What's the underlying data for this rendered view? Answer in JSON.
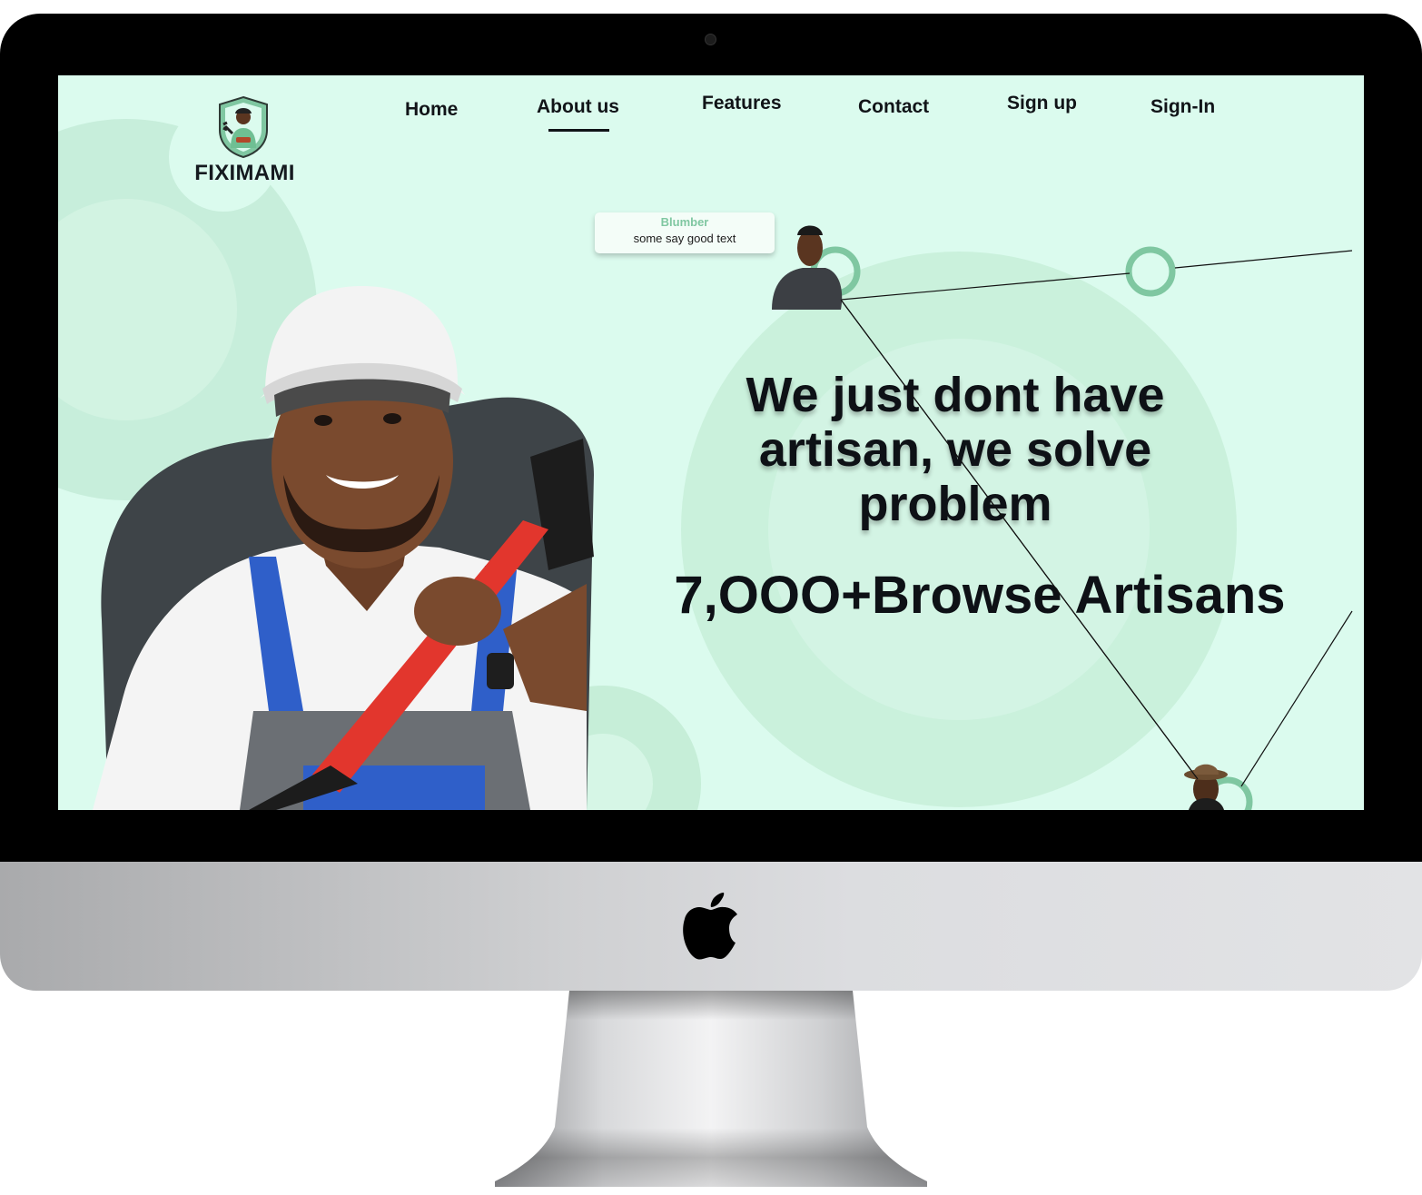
{
  "brand": {
    "name": "FIXIMAMI",
    "colors": {
      "accent": "#7fc7a1",
      "background": "#dbfbee",
      "dark": "#3e4448",
      "text": "#0e1116"
    }
  },
  "nav": {
    "items": [
      {
        "label": "Home",
        "active": false
      },
      {
        "label": "About us",
        "active": true
      },
      {
        "label": "Features",
        "active": false
      },
      {
        "label": "Contact",
        "active": false
      },
      {
        "label": "Sign up",
        "active": false
      },
      {
        "label": "Sign-In",
        "active": false
      }
    ]
  },
  "testimonial": {
    "name": "Blumber",
    "text": "some say good text"
  },
  "hero": {
    "headline": "We just dont have artisan, we solve problem",
    "stat": "7,OOO+Browse Artisans"
  },
  "icons": {
    "device_logo": "apple-logo",
    "brand_badge": "artisan-shield-icon"
  }
}
